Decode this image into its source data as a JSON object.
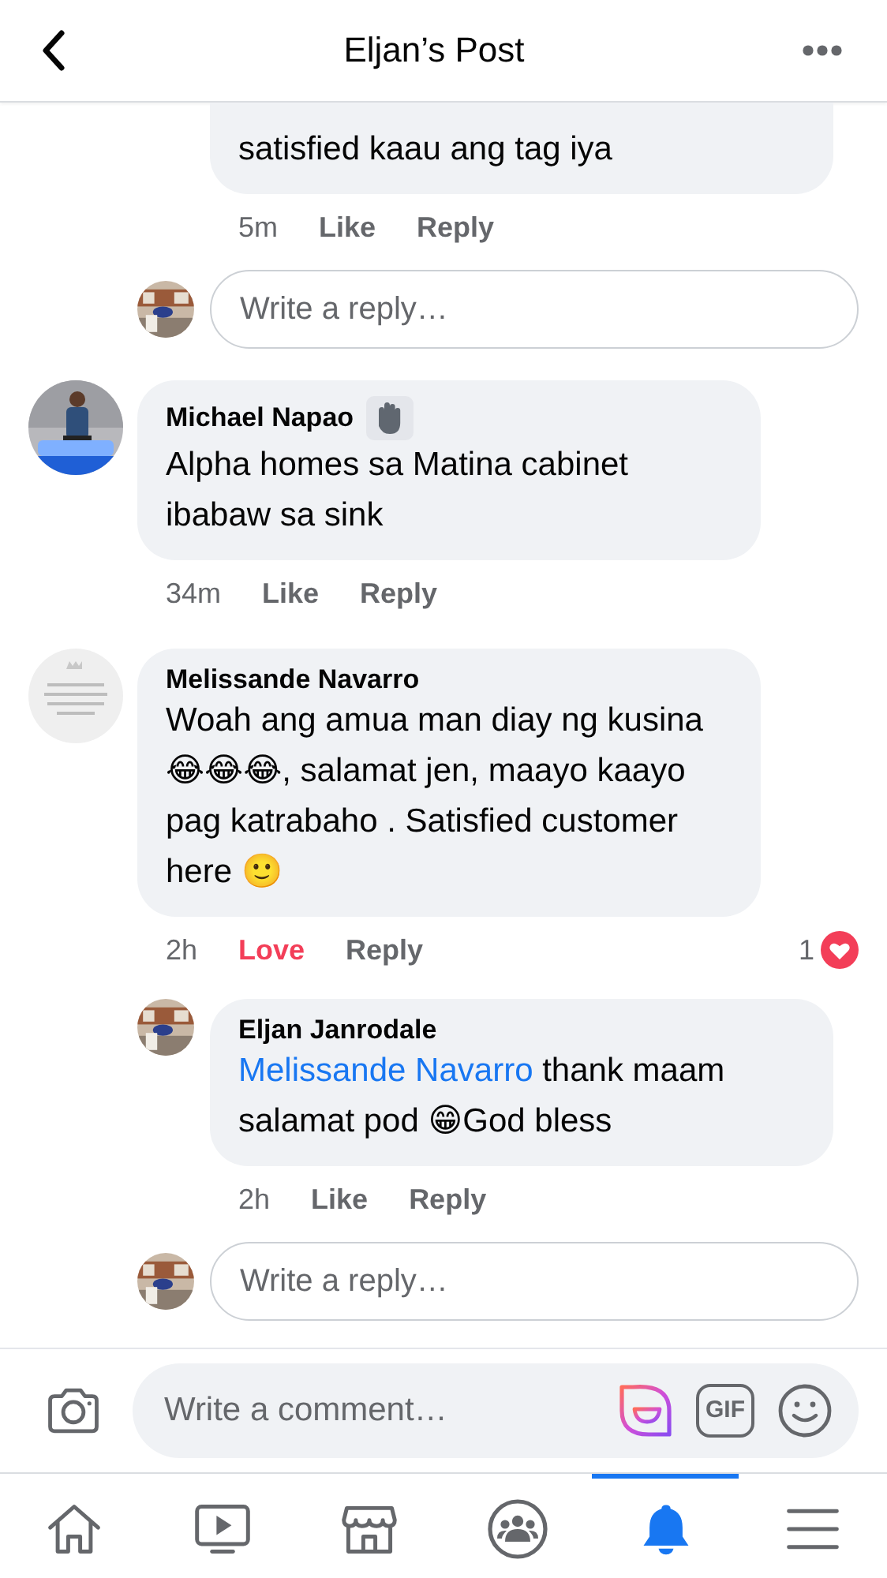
{
  "header": {
    "title": "Eljan’s Post"
  },
  "thread_top": {
    "replies": [
      {
        "text": "satisfied kaau ang tag iya",
        "actions": [
          {
            "kind": "time",
            "label": "5m"
          },
          {
            "kind": "like",
            "label": "Like",
            "reacted": false
          },
          {
            "kind": "reply",
            "label": "Reply"
          }
        ]
      }
    ],
    "reply_box": {
      "placeholder": "Write a reply…"
    }
  },
  "comments": [
    {
      "author": "Michael Napao",
      "has_badge": true,
      "text": "Alpha homes sa Matina cabinet ibabaw sa sink",
      "actions": [
        {
          "kind": "time",
          "label": "34m"
        },
        {
          "kind": "like",
          "label": "Like",
          "reacted": false
        },
        {
          "kind": "reply",
          "label": "Reply"
        }
      ]
    },
    {
      "author": "Melissande Navarro",
      "has_badge": false,
      "text": "Woah ang amua man diay ng kusina 😂😂😂, salamat jen, maayo kaayo pag katrabaho . Satisfied customer here 🙂",
      "actions": [
        {
          "kind": "time",
          "label": "2h"
        },
        {
          "kind": "like",
          "label": "Love",
          "reacted": true
        },
        {
          "kind": "reply",
          "label": "Reply"
        }
      ],
      "reaction_count": "1",
      "replies": [
        {
          "author": "Eljan Janrodale",
          "mention": "Melissande Navarro",
          "text": "thank maam salamat pod 😁God bless",
          "actions": [
            {
              "kind": "time",
              "label": "2h"
            },
            {
              "kind": "like",
              "label": "Like",
              "reacted": false
            },
            {
              "kind": "reply",
              "label": "Reply"
            }
          ]
        }
      ],
      "reply_box": {
        "placeholder": "Write a reply…"
      }
    }
  ],
  "composer": {
    "placeholder": "Write a comment…",
    "gif_label": "GIF"
  },
  "tabbar": [
    {
      "kind": "home",
      "selected": false
    },
    {
      "kind": "video",
      "selected": false
    },
    {
      "kind": "marketplace",
      "selected": false
    },
    {
      "kind": "groups",
      "selected": false
    },
    {
      "kind": "notifications",
      "selected": true
    },
    {
      "kind": "menu",
      "selected": false
    }
  ]
}
